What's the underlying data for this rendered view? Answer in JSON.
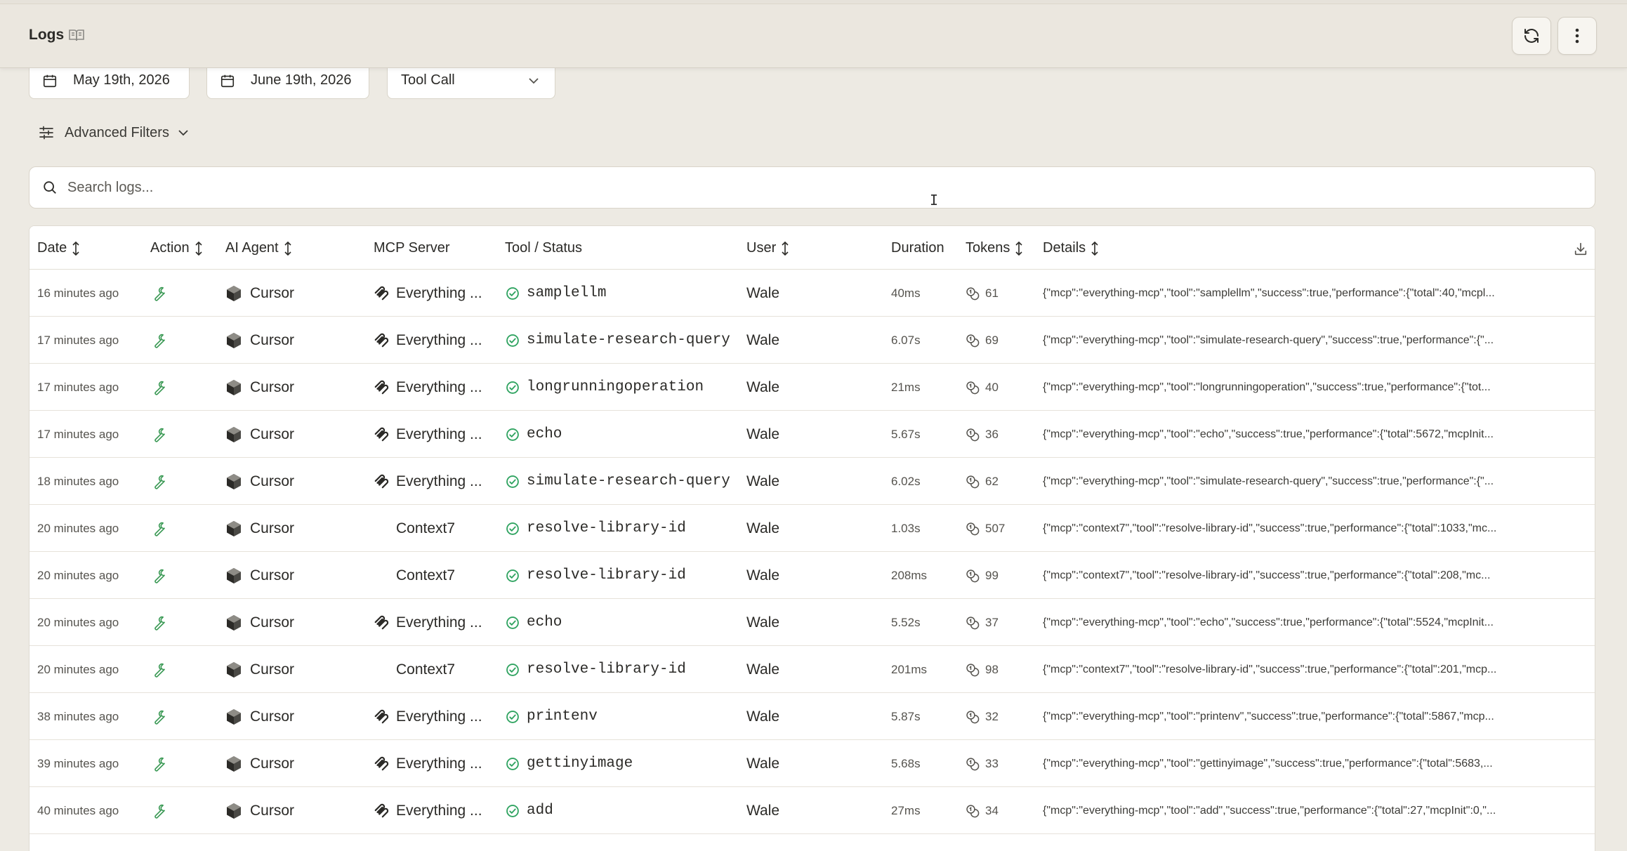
{
  "header": {
    "title": "Logs",
    "book_icon": "book-open-icon",
    "refresh_icon": "refresh-icon",
    "more_icon": "more-vertical-icon"
  },
  "filters": {
    "start_date": "May 19th, 2026",
    "end_date": "June 19th, 2026",
    "event_type": "Tool Call",
    "advanced_label": "Advanced Filters"
  },
  "search": {
    "placeholder": "Search logs..."
  },
  "table": {
    "columns": {
      "date": "Date",
      "action": "Action",
      "agent": "AI Agent",
      "server": "MCP Server",
      "tool": "Tool / Status",
      "user": "User",
      "duration": "Duration",
      "tokens": "Tokens",
      "details": "Details"
    },
    "rows": [
      {
        "date": "16 minutes ago",
        "agent": "Cursor",
        "server": "Everything ...",
        "server_icon": true,
        "tool": "samplellm",
        "user": "Wale",
        "duration": "40ms",
        "tokens": "61",
        "details": "{\"mcp\":\"everything-mcp\",\"tool\":\"samplellm\",\"success\":true,\"performance\":{\"total\":40,\"mcpl..."
      },
      {
        "date": "17 minutes ago",
        "agent": "Cursor",
        "server": "Everything ...",
        "server_icon": true,
        "tool": "simulate-research-query",
        "user": "Wale",
        "duration": "6.07s",
        "tokens": "69",
        "details": "{\"mcp\":\"everything-mcp\",\"tool\":\"simulate-research-query\",\"success\":true,\"performance\":{\"..."
      },
      {
        "date": "17 minutes ago",
        "agent": "Cursor",
        "server": "Everything ...",
        "server_icon": true,
        "tool": "longrunningoperation",
        "user": "Wale",
        "duration": "21ms",
        "tokens": "40",
        "details": "{\"mcp\":\"everything-mcp\",\"tool\":\"longrunningoperation\",\"success\":true,\"performance\":{\"tot..."
      },
      {
        "date": "17 minutes ago",
        "agent": "Cursor",
        "server": "Everything ...",
        "server_icon": true,
        "tool": "echo",
        "user": "Wale",
        "duration": "5.67s",
        "tokens": "36",
        "details": "{\"mcp\":\"everything-mcp\",\"tool\":\"echo\",\"success\":true,\"performance\":{\"total\":5672,\"mcpInit..."
      },
      {
        "date": "18 minutes ago",
        "agent": "Cursor",
        "server": "Everything ...",
        "server_icon": true,
        "tool": "simulate-research-query",
        "user": "Wale",
        "duration": "6.02s",
        "tokens": "62",
        "details": "{\"mcp\":\"everything-mcp\",\"tool\":\"simulate-research-query\",\"success\":true,\"performance\":{\"..."
      },
      {
        "date": "20 minutes ago",
        "agent": "Cursor",
        "server": "Context7",
        "server_icon": false,
        "tool": "resolve-library-id",
        "user": "Wale",
        "duration": "1.03s",
        "tokens": "507",
        "details": "{\"mcp\":\"context7\",\"tool\":\"resolve-library-id\",\"success\":true,\"performance\":{\"total\":1033,\"mc..."
      },
      {
        "date": "20 minutes ago",
        "agent": "Cursor",
        "server": "Context7",
        "server_icon": false,
        "tool": "resolve-library-id",
        "user": "Wale",
        "duration": "208ms",
        "tokens": "99",
        "details": "{\"mcp\":\"context7\",\"tool\":\"resolve-library-id\",\"success\":true,\"performance\":{\"total\":208,\"mc..."
      },
      {
        "date": "20 minutes ago",
        "agent": "Cursor",
        "server": "Everything ...",
        "server_icon": true,
        "tool": "echo",
        "user": "Wale",
        "duration": "5.52s",
        "tokens": "37",
        "details": "{\"mcp\":\"everything-mcp\",\"tool\":\"echo\",\"success\":true,\"performance\":{\"total\":5524,\"mcpInit..."
      },
      {
        "date": "20 minutes ago",
        "agent": "Cursor",
        "server": "Context7",
        "server_icon": false,
        "tool": "resolve-library-id",
        "user": "Wale",
        "duration": "201ms",
        "tokens": "98",
        "details": "{\"mcp\":\"context7\",\"tool\":\"resolve-library-id\",\"success\":true,\"performance\":{\"total\":201,\"mcp..."
      },
      {
        "date": "38 minutes ago",
        "agent": "Cursor",
        "server": "Everything ...",
        "server_icon": true,
        "tool": "printenv",
        "user": "Wale",
        "duration": "5.87s",
        "tokens": "32",
        "details": "{\"mcp\":\"everything-mcp\",\"tool\":\"printenv\",\"success\":true,\"performance\":{\"total\":5867,\"mcp..."
      },
      {
        "date": "39 minutes ago",
        "agent": "Cursor",
        "server": "Everything ...",
        "server_icon": true,
        "tool": "gettinyimage",
        "user": "Wale",
        "duration": "5.68s",
        "tokens": "33",
        "details": "{\"mcp\":\"everything-mcp\",\"tool\":\"gettinyimage\",\"success\":true,\"performance\":{\"total\":5683,..."
      },
      {
        "date": "40 minutes ago",
        "agent": "Cursor",
        "server": "Everything ...",
        "server_icon": true,
        "tool": "add",
        "user": "Wale",
        "duration": "27ms",
        "tokens": "34",
        "details": "{\"mcp\":\"everything-mcp\",\"tool\":\"add\",\"success\":true,\"performance\":{\"total\":27,\"mcpInit\":0,\"..."
      }
    ]
  },
  "colors": {
    "background": "#edeae3",
    "success_green": "#2fa360",
    "accent_green": "#3c9a56"
  }
}
